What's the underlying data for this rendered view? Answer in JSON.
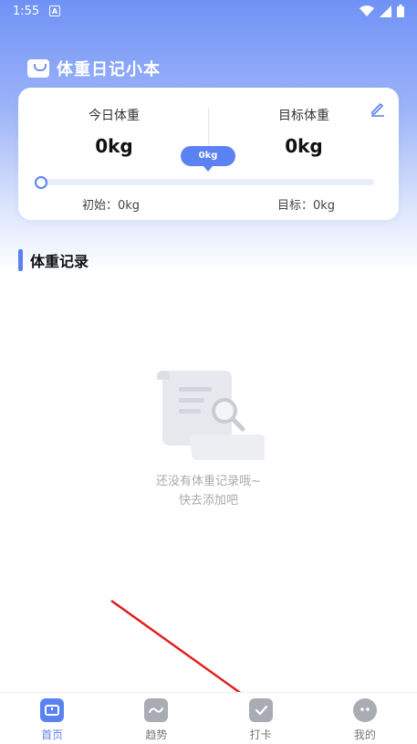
{
  "status_bar": {
    "time": "1:55",
    "notif": "A"
  },
  "app": {
    "title": "体重日记小本"
  },
  "card": {
    "today_label": "今日体重",
    "today_value": "0kg",
    "target_label": "目标体重",
    "target_value": "0kg",
    "bubble": "0kg",
    "initial_text": "初始：0kg",
    "goal_text": "目标：0kg",
    "progress": 0
  },
  "section": {
    "title": "体重记录"
  },
  "empty": {
    "line1": "还没有体重记录哦~",
    "line2": "快去添加吧"
  },
  "nav": [
    {
      "label": "首页",
      "icon": "scale-icon",
      "active": true
    },
    {
      "label": "趋势",
      "icon": "trend-icon",
      "active": false
    },
    {
      "label": "打卡",
      "icon": "checkin-icon",
      "active": false
    },
    {
      "label": "我的",
      "icon": "profile-icon",
      "active": false
    }
  ],
  "colors": {
    "accent": "#5b82f2",
    "annotation_arrow": "#e02020"
  }
}
